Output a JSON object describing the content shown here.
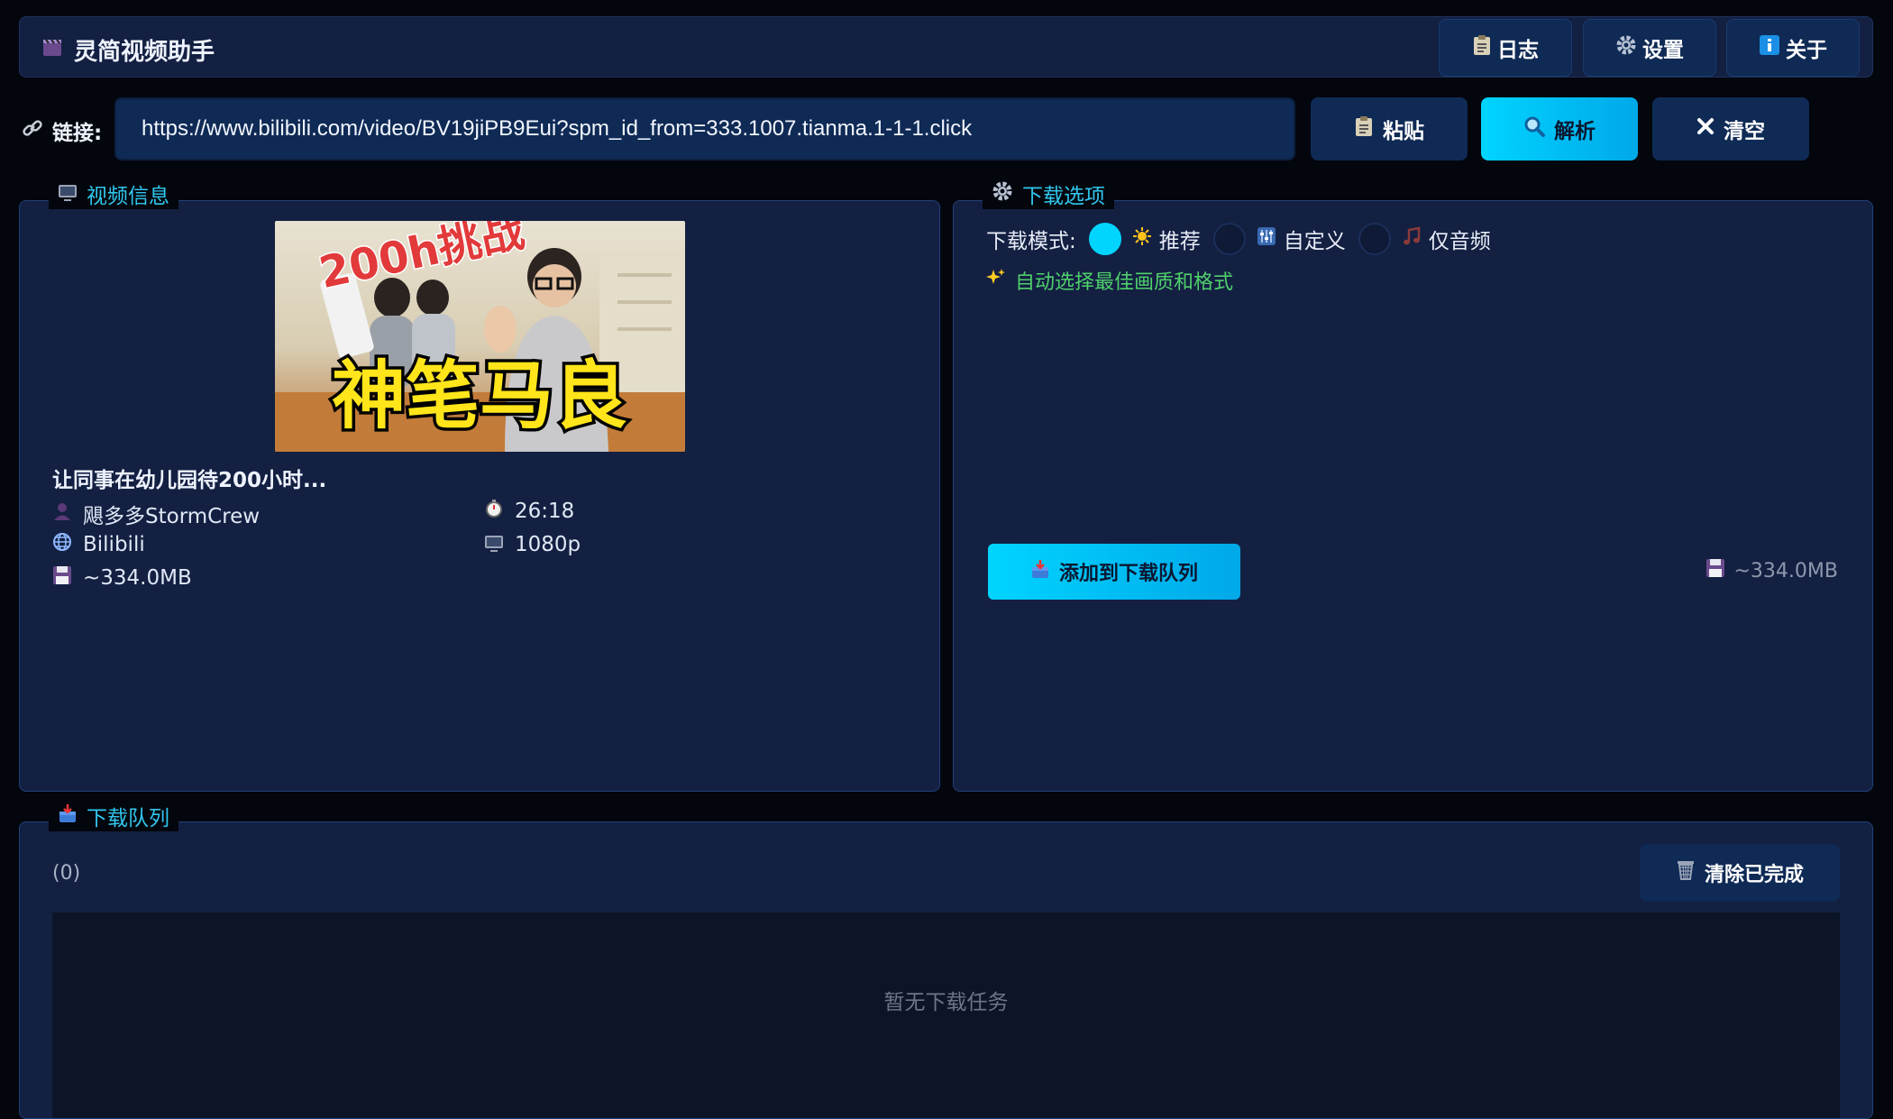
{
  "header": {
    "title": "灵简视频助手",
    "buttons": {
      "log": "日志",
      "settings": "设置",
      "about": "关于"
    }
  },
  "url_bar": {
    "label": "链接:",
    "value": "https://www.bilibili.com/video/BV19jiPB9Eui?spm_id_from=333.1007.tianma.1-1-1.click",
    "paste": "粘贴",
    "parse": "解析",
    "clear": "清空"
  },
  "video_info": {
    "legend": "视频信息",
    "thumbnail": {
      "headline": "200h挑战",
      "caption": "神笔马良"
    },
    "title": "让同事在幼儿园待200小时...",
    "uploader": "飓多多StormCrew",
    "duration": "26:18",
    "platform": "Bilibili",
    "resolution": "1080p",
    "size": "~334.0MB"
  },
  "download_options": {
    "legend": "下载选项",
    "mode_label": "下载模式:",
    "modes": [
      "推荐",
      "自定义",
      "仅音频"
    ],
    "selected_mode": 0,
    "hint": "自动选择最佳画质和格式",
    "add_button": "添加到下载队列",
    "est_size": "~334.0MB"
  },
  "queue": {
    "legend": "下载队列",
    "count": "(0)",
    "clear_done": "清除已完成",
    "empty_text": "暂无下载任务"
  },
  "colors": {
    "accent": "#00d4ff",
    "panel": "#132042",
    "button": "#0f2a55",
    "hint": "#4fcf6b"
  }
}
